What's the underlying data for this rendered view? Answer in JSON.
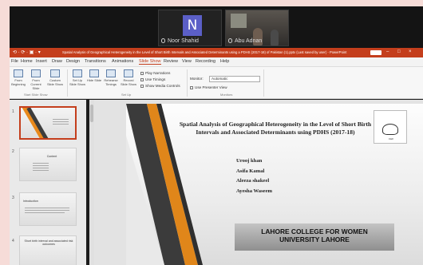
{
  "meeting": {
    "participants": [
      {
        "name": "Noor Shahid",
        "initial": "N"
      },
      {
        "name": "Abu Adnan"
      }
    ]
  },
  "app": {
    "quick_access": "⟲ · ⟳ · ▣ · ▾",
    "document_title": "Spatial Analysis of Geographical Heterogeneity in the Level of Short Birth Intervals and Associated Determinants using a PDHS (2017-18) of Pakistan (1).pptx (Last saved by user) - PowerPoint",
    "sign_in": "Sign in",
    "accent": "#c43e1c"
  },
  "tabs": [
    "File",
    "Home",
    "Insert",
    "Draw",
    "Design",
    "Transitions",
    "Animations",
    "Slide Show",
    "Review",
    "View",
    "Recording",
    "Help"
  ],
  "active_tab": "Slide Show",
  "ribbon": {
    "buttons": [
      {
        "label": "From Beginning",
        "icon": "play-icon"
      },
      {
        "label": "From Current Slide",
        "icon": "play-icon"
      },
      {
        "label": "Custom Slide Show",
        "icon": "slides-icon"
      },
      {
        "label": "Set Up Slide Show",
        "icon": "setup-icon"
      },
      {
        "label": "Hide Slide",
        "icon": "hide-icon"
      },
      {
        "label": "Rehearse Timings",
        "icon": "timer-icon"
      },
      {
        "label": "Record Slide Show",
        "icon": "record-icon"
      }
    ],
    "checks": [
      "Play Narrations",
      "Use Timings",
      "Show Media Controls"
    ],
    "monitor_label": "Monitor:",
    "monitor_value": "Automatic",
    "presenter_view": "Use Presenter View",
    "groups": [
      "Start Slide Show",
      "Set Up",
      "Monitors"
    ]
  },
  "thumbnails": [
    {
      "num": "1",
      "title": ""
    },
    {
      "num": "2",
      "title": "Content"
    },
    {
      "num": "3",
      "title": "Introduction"
    },
    {
      "num": "4",
      "title": "Short birth interval and associated risk outcomes"
    }
  ],
  "slide": {
    "title": "Spatial Analysis of Geographical Heterogeneity in the Level of Short Birth Intervals and Associated Determinants using PDHS (2017-18)",
    "authors": [
      "Urooj khan",
      "Asifa Kamal",
      "Aleeza shakeel",
      "Ayesha Waseem"
    ],
    "institution_line1": "LAHORE COLLEGE FOR WOMEN",
    "institution_line2": "UNIVERSITY LAHORE",
    "logo_text": "1922"
  }
}
